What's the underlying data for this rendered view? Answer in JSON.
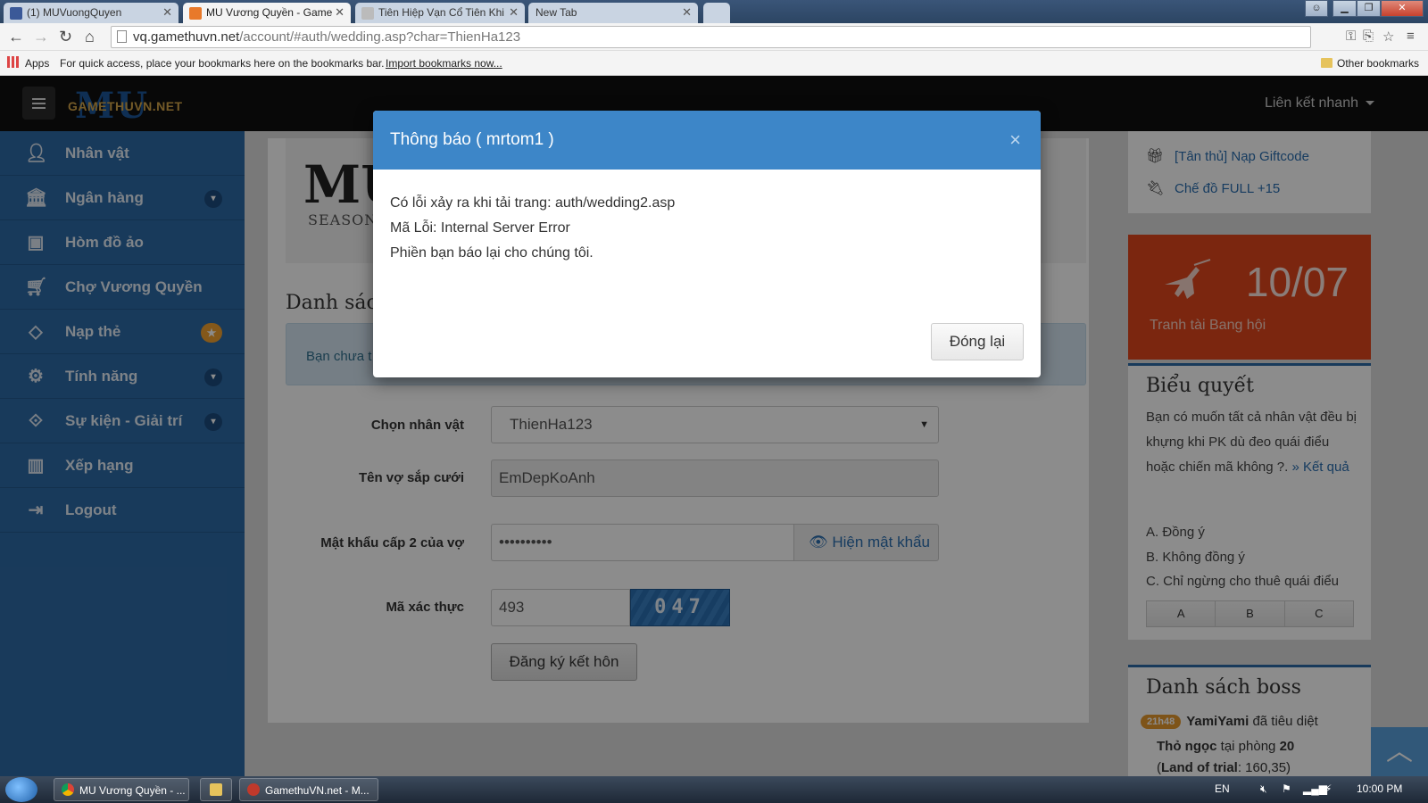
{
  "browser": {
    "tabs": [
      {
        "label": "(1) MUVuongQuyen",
        "color": "#3b5998"
      },
      {
        "label": "MU Vương Quyền - Game",
        "color": "#e8792a"
      },
      {
        "label": "Tiên Hiệp Vạn Cổ Tiên Khi",
        "color": "#999999"
      },
      {
        "label": "New Tab",
        "color": ""
      }
    ],
    "url_host": "vq.gamethuvn.net",
    "url_path": "/account/#auth/wedding.asp?char=ThienHa123",
    "bookmarks": {
      "apps": "Apps",
      "hint": "For quick access, place your bookmarks here on the bookmarks bar.",
      "import": "Import bookmarks now...",
      "other": "Other bookmarks"
    }
  },
  "header": {
    "logo_text": "GAMETHUVN.NET",
    "logo_mark": "MU",
    "quick_links": "Liên kết nhanh"
  },
  "sidebar": {
    "items": [
      {
        "label": "Nhân vật",
        "icon": "user-icon"
      },
      {
        "label": "Ngân hàng",
        "icon": "bank-icon"
      },
      {
        "label": "Hòm đồ ảo",
        "icon": "suitcase-icon"
      },
      {
        "label": "Chợ Vương Quyền",
        "icon": "cart-icon"
      },
      {
        "label": "Nạp thẻ",
        "icon": "diamond-icon"
      },
      {
        "label": "Tính năng",
        "icon": "gears-icon"
      },
      {
        "label": "Sự kiện - Giải trí",
        "icon": "event-icon"
      },
      {
        "label": "Xếp hạng",
        "icon": "chart-icon"
      },
      {
        "label": "Logout",
        "icon": "logout-icon"
      }
    ]
  },
  "main": {
    "banner_brand": "MU",
    "banner_season": "SEASON",
    "section_title": "Danh sách",
    "alert_text": "Bạn chưa t",
    "form": {
      "char_label": "Chọn nhân vật",
      "char_value": "ThienHa123",
      "wife_label": "Tên vợ sắp cưới",
      "wife_value": "EmDepKoAnh",
      "pass_label": "Mật khẩu cấp 2 của vợ",
      "pass_value": "••••••••••",
      "show_pass": "Hiện mật khẩu",
      "captcha_label": "Mã xác thực",
      "captcha_value": "493",
      "captcha_image_text": "047",
      "submit": "Đăng ký kết hôn"
    }
  },
  "right": {
    "links": [
      {
        "label": "[Tân thủ] Nạp Giftcode",
        "icon": "gift-icon"
      },
      {
        "label": "Chế đồ FULL +15",
        "icon": "plug-icon"
      }
    ],
    "event": {
      "date": "10/07",
      "title": "Tranh tài Bang hội"
    },
    "poll": {
      "title": "Biểu quyết",
      "question": "Bạn có muốn tất cả nhân vật đều bị khựng khi PK dù đeo quái điểu hoặc chiến mã không ?.",
      "result_link": "» Kết quả",
      "options": [
        "A. Đồng ý",
        "B. Không đồng ý",
        "C. Chỉ ngừng cho thuê quái điểu"
      ],
      "buttons": [
        "A",
        "B",
        "C"
      ]
    },
    "boss": {
      "title": "Danh sách boss",
      "time": "21h48",
      "killer": "YamiYami",
      "killed_text": "đã tiêu diệt",
      "boss_name": "Thỏ ngọc",
      "room_text": "tại phòng",
      "room": "20",
      "map": "Land of trial",
      "coords": ": 160,35)"
    }
  },
  "modal": {
    "title": "Thông báo ( mrtom1 )",
    "close": "×",
    "lines": [
      "Có lỗi xảy ra khi tải trang: auth/wedding2.asp",
      "Mã Lỗi: Internal Server Error",
      "Phiền bạn báo lại cho chúng tôi."
    ],
    "button": "Đóng lại"
  },
  "taskbar": {
    "tasks": [
      "MU Vương Quyền - ...",
      "GamethuVN.net - M..."
    ],
    "lang": "EN",
    "time": "10:00 PM"
  }
}
